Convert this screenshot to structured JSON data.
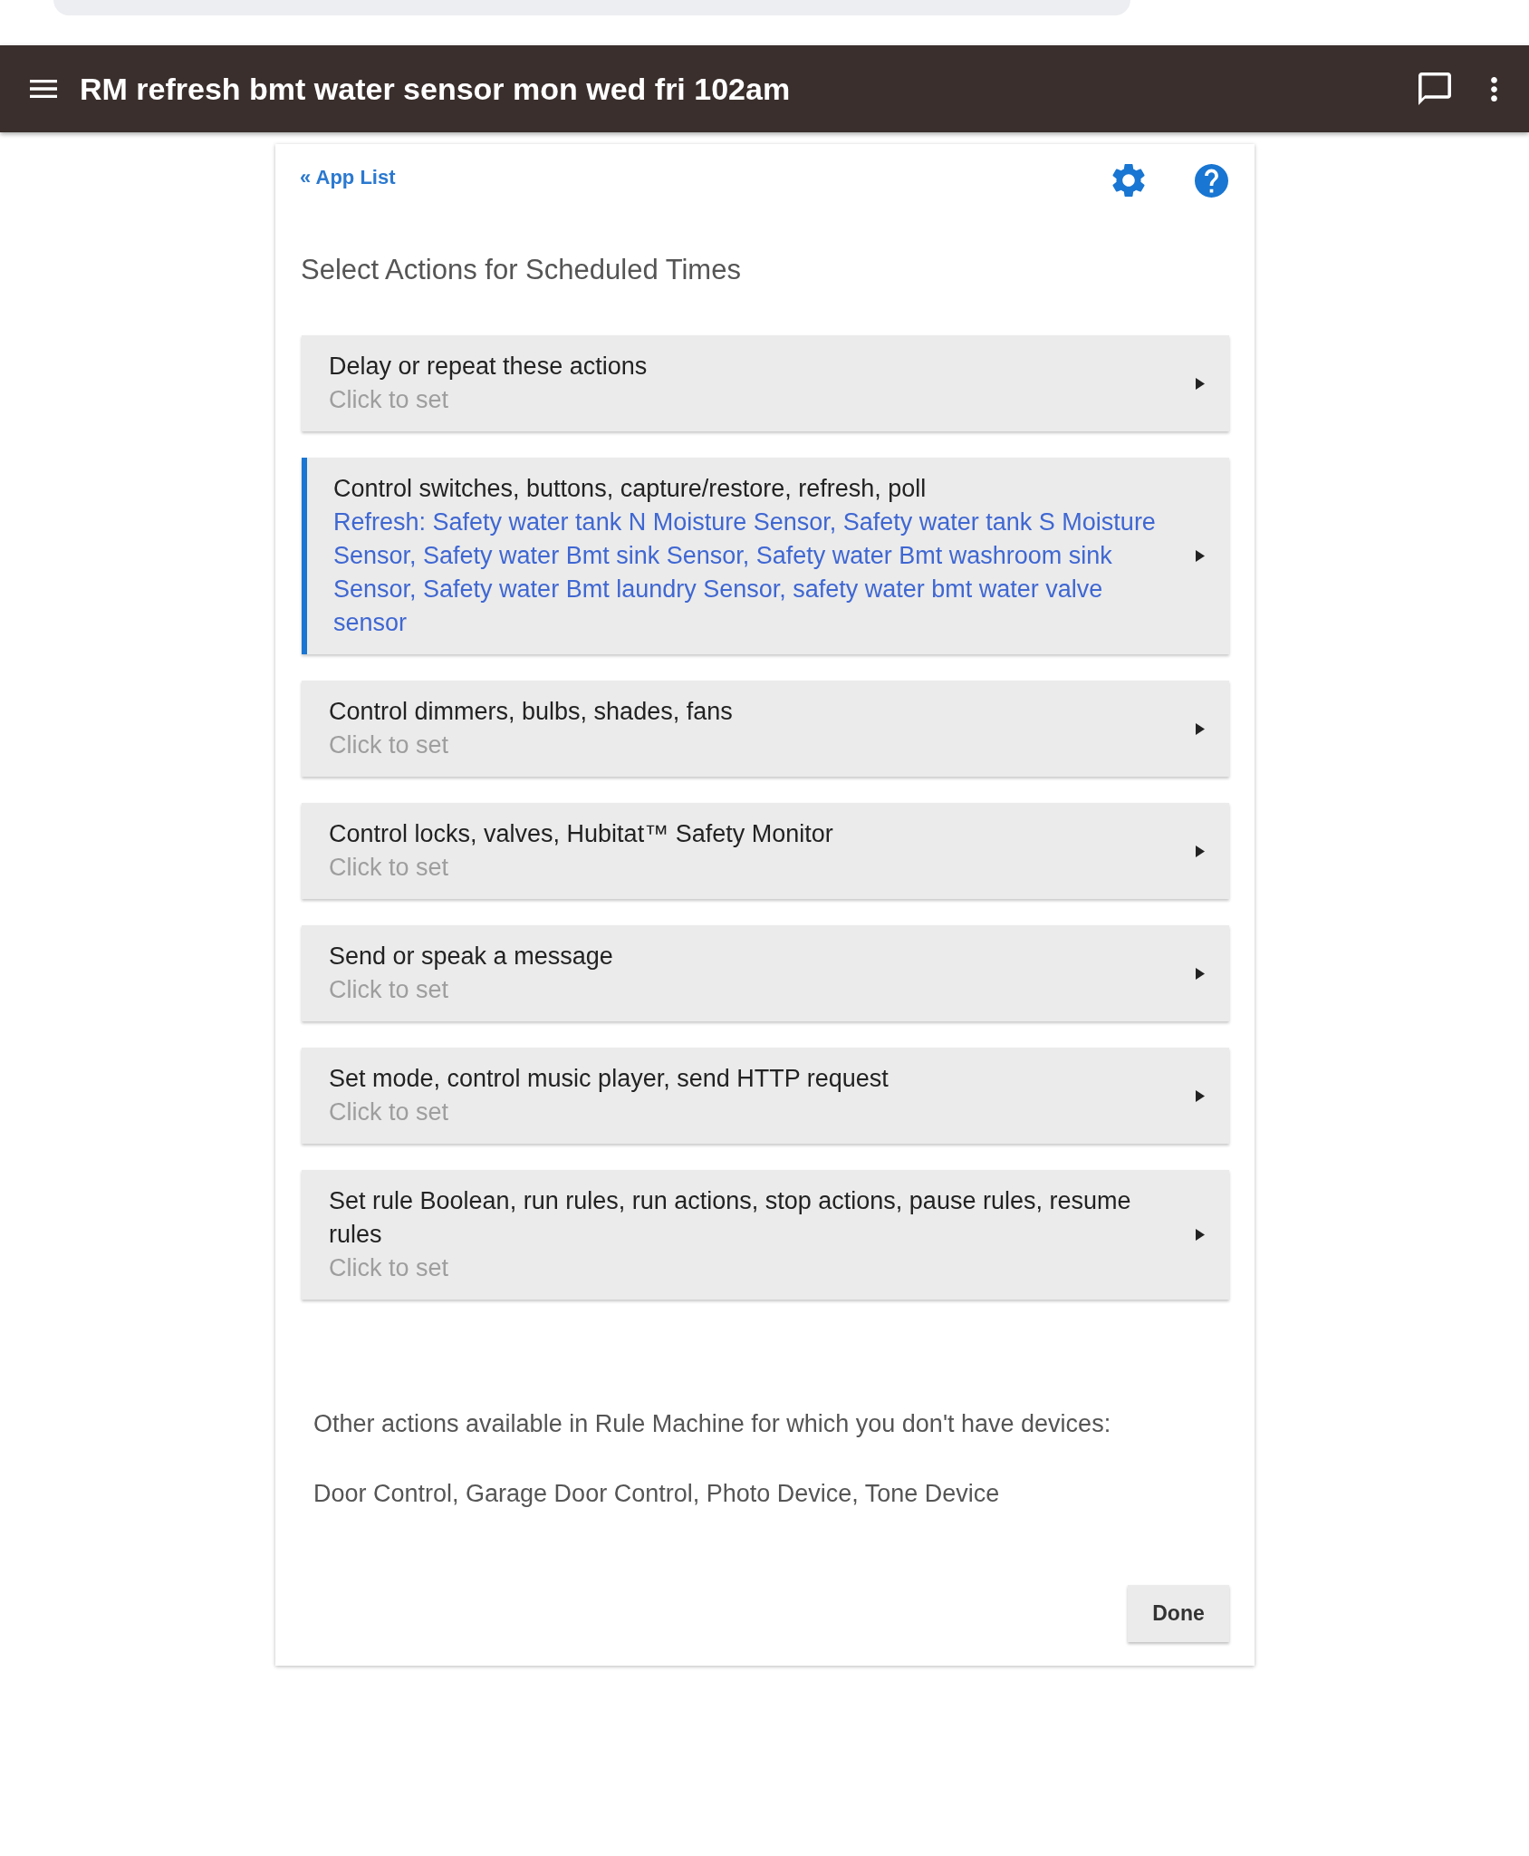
{
  "app_bar": {
    "title": "RM refresh bmt water sensor mon wed fri 102am"
  },
  "card": {
    "back_link": "« App List",
    "heading": "Select Actions for Scheduled Times",
    "actions": [
      {
        "title": "Delay or repeat these actions",
        "value": "Click to set",
        "configured": false
      },
      {
        "title": "Control switches, buttons, capture/restore, refresh, poll",
        "value": "Refresh: Safety water tank N Moisture Sensor, Safety water tank S Moisture Sensor, Safety water Bmt sink Sensor, Safety water Bmt washroom sink Sensor, Safety water Bmt laundry Sensor, safety water bmt water valve sensor",
        "configured": true
      },
      {
        "title": "Control dimmers, bulbs, shades, fans",
        "value": "Click to set",
        "configured": false
      },
      {
        "title": "Control locks, valves, Hubitat™ Safety Monitor",
        "value": "Click to set",
        "configured": false
      },
      {
        "title": "Send or speak a message",
        "value": "Click to set",
        "configured": false
      },
      {
        "title": "Set mode, control music player, send HTTP request",
        "value": "Click to set",
        "configured": false
      },
      {
        "title": "Set rule Boolean, run rules, run actions, stop actions, pause rules, resume rules",
        "value": "Click to set",
        "configured": false
      }
    ],
    "unavailable_note": "Other actions available in Rule Machine for which you don't have devices:",
    "unavailable_list": "Door Control, Garage Door Control, Photo Device, Tone Device",
    "done_button": "Done"
  }
}
